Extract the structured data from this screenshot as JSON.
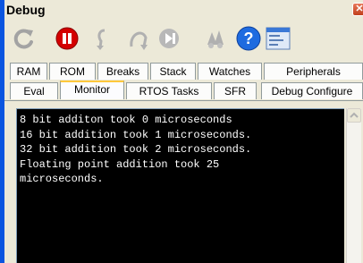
{
  "window": {
    "title": "Debug",
    "close_glyph": "✕"
  },
  "toolbar": {
    "buttons": [
      {
        "name": "reset-icon",
        "enabled": false
      },
      {
        "name": "stop-icon",
        "enabled": true,
        "color": "#d40000"
      },
      {
        "name": "step-into-icon",
        "enabled": false
      },
      {
        "name": "step-over-icon",
        "enabled": false
      },
      {
        "name": "step-out-icon",
        "enabled": false
      },
      {
        "name": "breakpoints-icon",
        "enabled": false
      },
      {
        "name": "help-icon",
        "enabled": true,
        "color": "#1e6be0"
      },
      {
        "name": "settings-list-icon",
        "enabled": true
      }
    ]
  },
  "tabs_row1": [
    "RAM",
    "ROM",
    "Breaks",
    "Stack",
    "Watches",
    "Peripherals"
  ],
  "tabs_row2": [
    "Eval",
    "Monitor",
    "RTOS Tasks",
    "SFR",
    "Debug Configure"
  ],
  "active_tab": "Monitor",
  "console": {
    "lines": [
      "8 bit additon took 0 microseconds",
      "16 bit addition took 1 microseconds.",
      "32 bit addition took 2 microseconds.",
      "Floating point addition took 25",
      "microseconds."
    ]
  },
  "colors": {
    "desktop": "#0a55e0",
    "panel": "#ece9d8",
    "console_bg": "#000000",
    "console_fg": "#ffffff",
    "active_tab_accent": "#ffc83c"
  }
}
